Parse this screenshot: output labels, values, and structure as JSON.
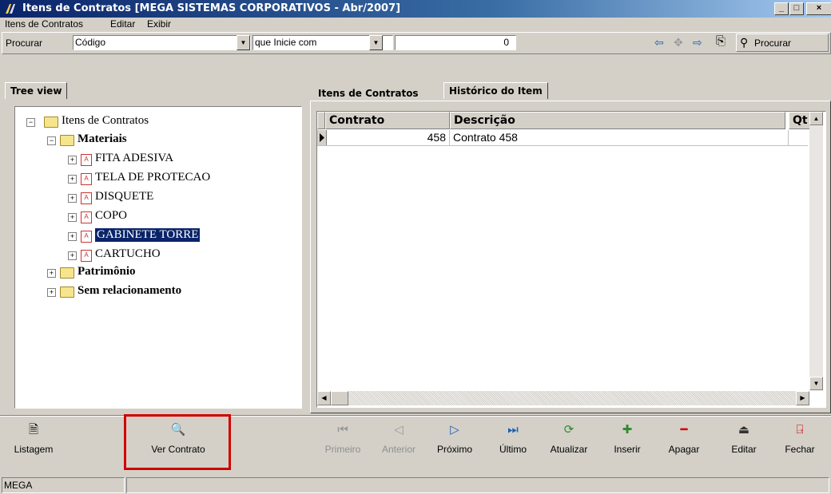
{
  "window": {
    "title": "Itens de Contratos [MEGA SISTEMAS CORPORATIVOS - Abr/2007]",
    "min": "_",
    "max": "□",
    "close": "×"
  },
  "menu": [
    "Itens de Contratos",
    "Editar",
    "Exibir"
  ],
  "search": {
    "label": "Procurar",
    "field_value": "Código",
    "mode_value": "que Inicie com",
    "text_value": "",
    "count_value": "0",
    "button_label": "Procurar"
  },
  "tree": {
    "tab_label": "Tree view",
    "root": "Itens de Contratos",
    "groups": [
      {
        "label": "Materiais",
        "items": [
          "FITA ADESIVA",
          "TELA DE PROTECAO",
          "DISQUETE",
          "COPO",
          "GABINETE TORRE",
          "CARTUCHO"
        ]
      },
      {
        "label": "Patrimônio"
      },
      {
        "label": "Sem relacionamento"
      }
    ],
    "selected": "GABINETE TORRE"
  },
  "tabs": [
    "Itens de Contratos",
    "Histórico do Item"
  ],
  "grid": {
    "columns": [
      "Contrato",
      "Descrição",
      "Qt"
    ],
    "rows": [
      {
        "contrato": "458",
        "descricao": "Contrato 458"
      }
    ]
  },
  "left_buttons": [
    "Listagem",
    "Ver Contrato"
  ],
  "nav_buttons": [
    {
      "label": "Primeiro",
      "enabled": false
    },
    {
      "label": "Anterior",
      "enabled": false
    },
    {
      "label": "Próximo",
      "enabled": true
    },
    {
      "label": "Último",
      "enabled": true
    },
    {
      "label": "Atualizar",
      "enabled": true
    },
    {
      "label": "Inserir",
      "enabled": true
    },
    {
      "label": "Apagar",
      "enabled": true
    },
    {
      "label": "Editar",
      "enabled": true
    },
    {
      "label": "Fechar",
      "enabled": true
    }
  ],
  "status": {
    "panel1": "MEGA"
  },
  "colors": {
    "highlight": "#d00000",
    "selection": "#0a246a"
  }
}
